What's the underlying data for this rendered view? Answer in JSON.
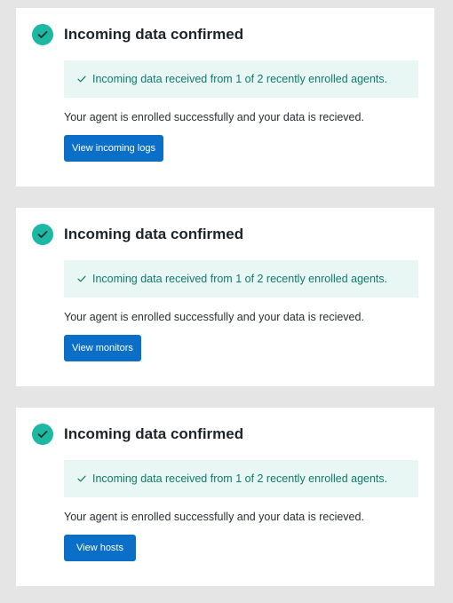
{
  "colors": {
    "page_background": "#e5e5e5",
    "success_icon": "#1cb8a3",
    "callout_background": "#e8f6f4",
    "callout_text": "#117a6c",
    "primary_button": "#0b6fc7"
  },
  "panels": [
    {
      "icon": "check-circle-icon",
      "title": "Incoming data confirmed",
      "callout": {
        "icon": "checkmark-icon",
        "text": "Incoming data received from 1 of 2 recently enrolled agents."
      },
      "body": "Your agent is enrolled successfully and your data is recieved.",
      "button_label": "View incoming logs"
    },
    {
      "icon": "check-circle-icon",
      "title": "Incoming data confirmed",
      "callout": {
        "icon": "checkmark-icon",
        "text": "Incoming data received from 1 of 2 recently enrolled agents."
      },
      "body": "Your agent is enrolled successfully and your data is recieved.",
      "button_label": "View monitors"
    },
    {
      "icon": "check-circle-icon",
      "title": "Incoming data confirmed",
      "callout": {
        "icon": "checkmark-icon",
        "text": "Incoming data received from 1 of 2 recently enrolled agents."
      },
      "body": "Your agent is enrolled successfully and your data is recieved.",
      "button_label": "View hosts"
    }
  ]
}
